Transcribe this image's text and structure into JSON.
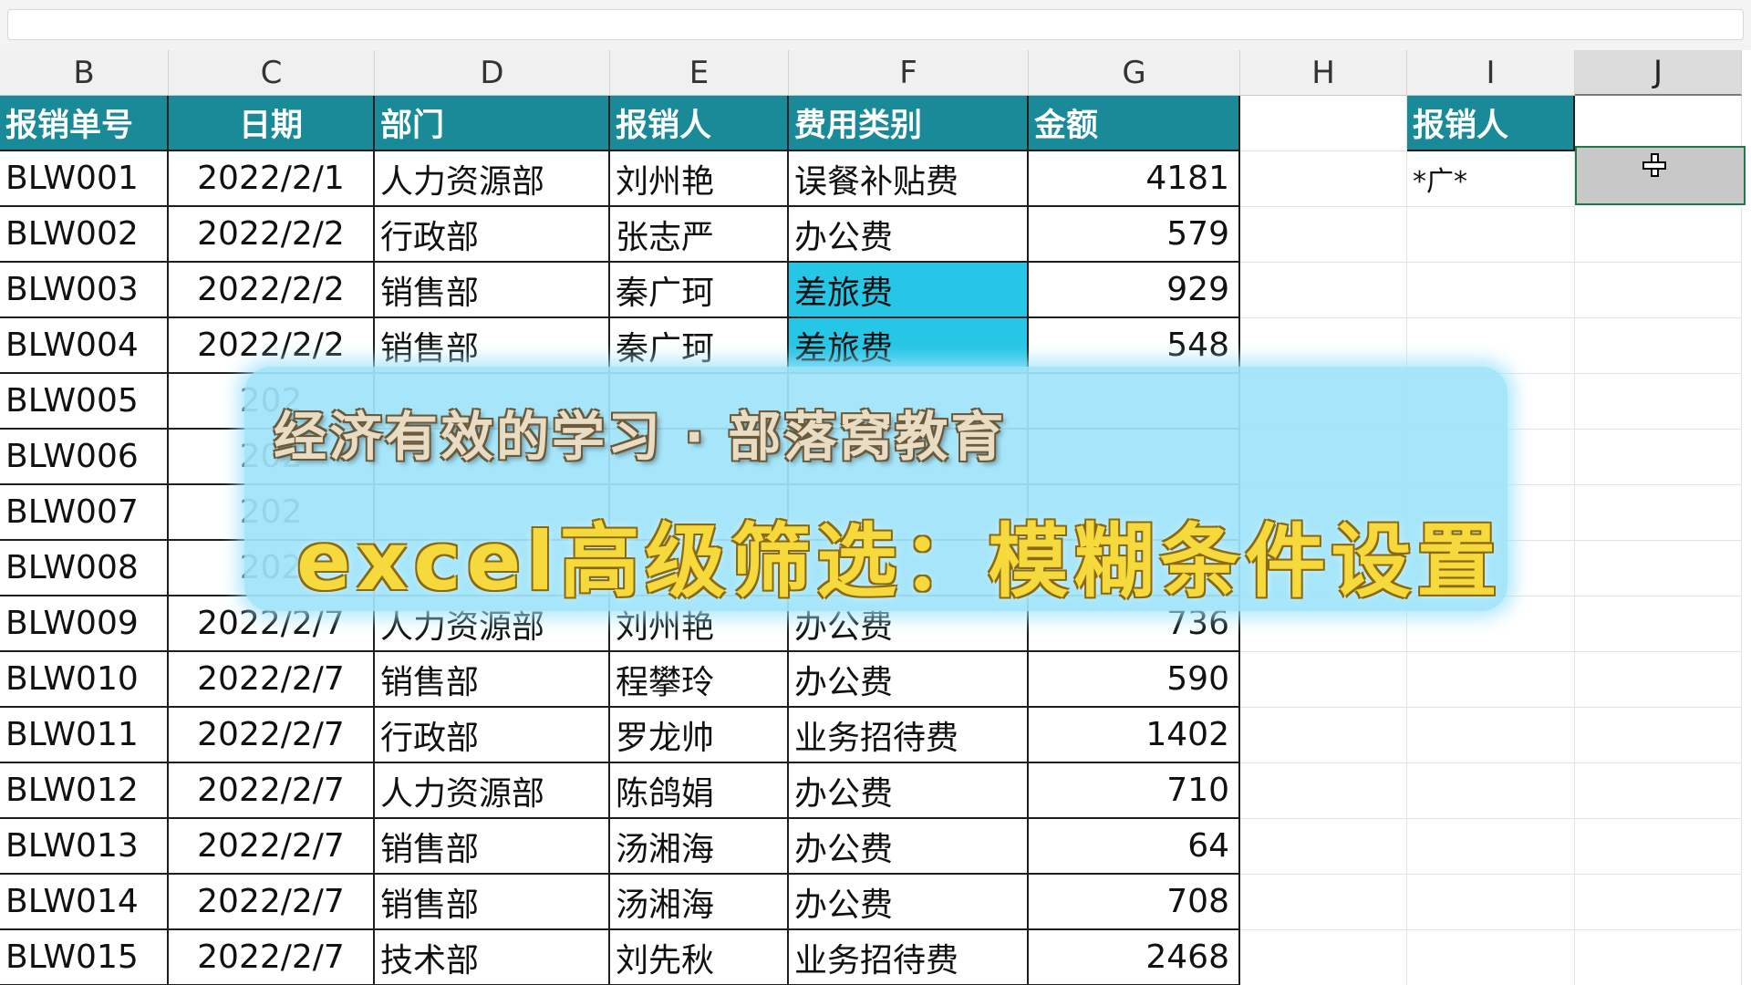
{
  "columns": [
    "B",
    "C",
    "D",
    "E",
    "F",
    "G",
    "H",
    "I",
    "J"
  ],
  "table": {
    "headers": [
      "报销单号",
      "日期",
      "部门",
      "报销人",
      "费用类别",
      "金额"
    ],
    "rows": [
      [
        "BLW001",
        "2022/2/1",
        "人力资源部",
        "刘州艳",
        "误餐补贴费",
        "4181"
      ],
      [
        "BLW002",
        "2022/2/2",
        "行政部",
        "张志严",
        "办公费",
        "579"
      ],
      [
        "BLW003",
        "2022/2/2",
        "销售部",
        "秦广珂",
        "差旅费",
        "929"
      ],
      [
        "BLW004",
        "2022/2/2",
        "销售部",
        "秦广珂",
        "差旅费",
        "548"
      ],
      [
        "BLW005",
        "202",
        "",
        "",
        "",
        ""
      ],
      [
        "BLW006",
        "202",
        "",
        "",
        "",
        ""
      ],
      [
        "BLW007",
        "202",
        "",
        "",
        "",
        ""
      ],
      [
        "BLW008",
        "202",
        "",
        "",
        "",
        ""
      ],
      [
        "BLW009",
        "2022/2/7",
        "人力资源部",
        "刘州艳",
        "办公费",
        "736"
      ],
      [
        "BLW010",
        "2022/2/7",
        "销售部",
        "程攀玲",
        "办公费",
        "590"
      ],
      [
        "BLW011",
        "2022/2/7",
        "行政部",
        "罗龙帅",
        "业务招待费",
        "1402"
      ],
      [
        "BLW012",
        "2022/2/7",
        "人力资源部",
        "陈鸽娟",
        "办公费",
        "710"
      ],
      [
        "BLW013",
        "2022/2/7",
        "销售部",
        "汤湘海",
        "办公费",
        "64"
      ],
      [
        "BLW014",
        "2022/2/7",
        "销售部",
        "汤湘海",
        "办公费",
        "708"
      ],
      [
        "BLW015",
        "2022/2/7",
        "技术部",
        "刘先秋",
        "业务招待费",
        "2468"
      ]
    ],
    "highlighted_rows": [
      2,
      3
    ]
  },
  "criteria": {
    "header": "报销人",
    "value": "*广*"
  },
  "colors": {
    "header_bg": "#1a8a99",
    "highlight": "#26c6e6",
    "banner_bg": "#a0e4fa",
    "title_gold": "#f6d93c"
  },
  "banner": {
    "subtitle": "经济有效的学习 · 部落窝教育",
    "title": "excel高级筛选：模糊条件设置"
  }
}
